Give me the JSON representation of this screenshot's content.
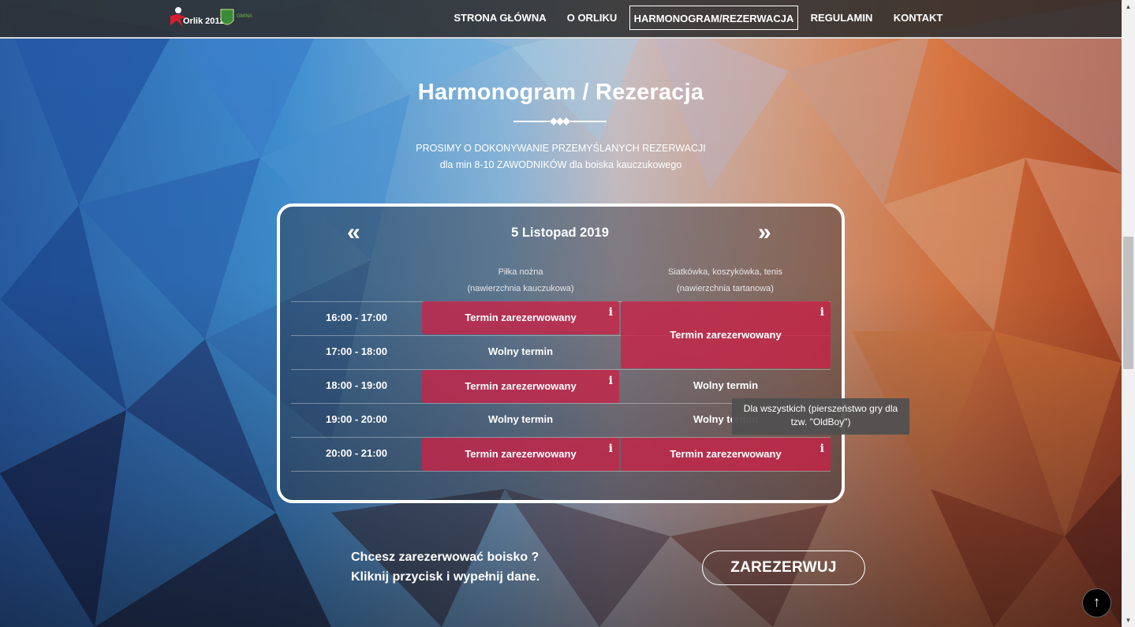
{
  "nav": {
    "logo_text": "Orlik 2012",
    "crest_text": "GMINA",
    "items": [
      {
        "label": "STRONA GŁÓWNA"
      },
      {
        "label": "O ORLIKU"
      },
      {
        "label": "HARMONOGRAM/REZERWACJA",
        "active": true
      },
      {
        "label": "REGULAMIN"
      },
      {
        "label": "KONTAKT"
      }
    ]
  },
  "page": {
    "title": "Harmonogram / Rezeracja",
    "subtitle_line1": "PROSIMY O DOKONYWANIE PRZEMYŚLANYCH REZERWACJI",
    "subtitle_line2": "dla min 8-10 ZAWODNIKÓW dla boiska kauczukowego"
  },
  "schedule": {
    "prev_icon": "«",
    "next_icon": "»",
    "date": "5 Listopad 2019",
    "columns": [
      {
        "name": "Piłka nożna",
        "surface": "(nawierzchnia kauczukowa)"
      },
      {
        "name": "Siatkówka, koszykówka, tenis",
        "surface": "(nawierzchnia tartanowa)"
      }
    ],
    "times": [
      "16:00 - 17:00",
      "17:00 - 18:00",
      "18:00 - 19:00",
      "19:00 - 20:00",
      "20:00 - 21:00"
    ],
    "cells": {
      "c1_16": "Termin zarezerwowany",
      "c1_17": "Wolny termin",
      "c1_18": "Termin zarezerwowany",
      "c1_19": "Wolny termin",
      "c1_20": "Termin zarezerwowany",
      "c2_16_18": "Termin zarezerwowany",
      "c2_18": "Wolny termin",
      "c2_19": "Wolny termin",
      "c2_20": "Termin zarezerwowany"
    },
    "info_icon": "i",
    "reserved_color": "#c62448",
    "tooltip_line1": "Dla wszystkich (pierszeństwo gry dla",
    "tooltip_line2": "tzw. \"OldBoy\")"
  },
  "cta": {
    "line1": "Chcesz zarezerwować boisko ?",
    "line2": "Kliknij przycisk i wypełnij dane.",
    "button": "ZAREZERWUJ"
  },
  "scroll_top_icon": "↑"
}
